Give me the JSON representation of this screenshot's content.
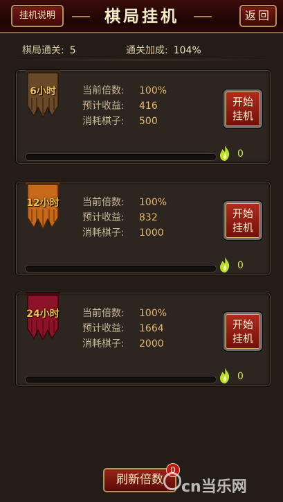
{
  "header": {
    "help_label": "挂机说明",
    "title": "棋局挂机",
    "back_label": "返回"
  },
  "stats": {
    "level_label": "棋局通关:",
    "level_value": "5",
    "bonus_label": "通关加成:",
    "bonus_value": "104%"
  },
  "cards": [
    {
      "duration": "6小时",
      "multiplier_label": "当前倍数:",
      "multiplier": "100%",
      "income_label": "预计收益:",
      "income": "416",
      "cost_label": "消耗棋子:",
      "cost": "500",
      "button_line1": "开始",
      "button_line2": "挂机",
      "progress": 0,
      "count": "0",
      "banner_color": "#6b4a2a"
    },
    {
      "duration": "12小时",
      "multiplier_label": "当前倍数:",
      "multiplier": "100%",
      "income_label": "预计收益:",
      "income": "832",
      "cost_label": "消耗棋子:",
      "cost": "1000",
      "button_line1": "开始",
      "button_line2": "挂机",
      "progress": 0,
      "count": "0",
      "banner_color": "#c8691a"
    },
    {
      "duration": "24小时",
      "multiplier_label": "当前倍数:",
      "multiplier": "100%",
      "income_label": "预计收益:",
      "income": "1664",
      "cost_label": "消耗棋子:",
      "cost": "2000",
      "button_line1": "开始",
      "button_line2": "挂机",
      "progress": 0,
      "count": "0",
      "banner_color": "#8e1228"
    }
  ],
  "refresh": {
    "label": "刷新倍数",
    "badge": "0"
  },
  "watermark": "cn当乐网",
  "icons": {
    "banner": "banner-icon",
    "flame": "flame-icon"
  }
}
